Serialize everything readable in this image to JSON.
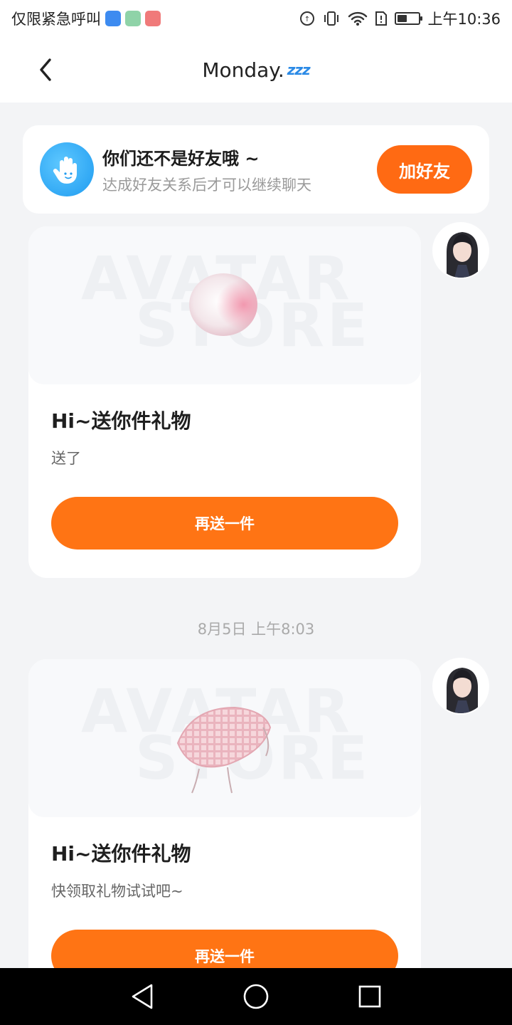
{
  "status_bar": {
    "left_text": "仅限紧急呼叫",
    "time": "上午10:36",
    "battery_level": 0.45
  },
  "header": {
    "title": "Monday.",
    "title_emoji": "zzz"
  },
  "friend_banner": {
    "title": "你们还不是好友哦 ~",
    "subtitle": "达成好友关系后才可以继续聊天",
    "button_label": "加好友"
  },
  "messages": [
    {
      "title": "Hi~送你件礼物",
      "text": "送了",
      "button_label": "再送一件",
      "gift_icon": "peach-bun-icon"
    },
    {
      "timestamp": "8月5日 上午8:03",
      "title": "Hi~送你件礼物",
      "text": "快领取礼物试试吧~",
      "button_label": "再送一件",
      "gift_icon": "pink-bonnet-icon"
    }
  ],
  "watermark": [
    "AVATAR",
    "STORE"
  ],
  "colors": {
    "accent": "#ff6a13",
    "background": "#f3f4f6"
  }
}
